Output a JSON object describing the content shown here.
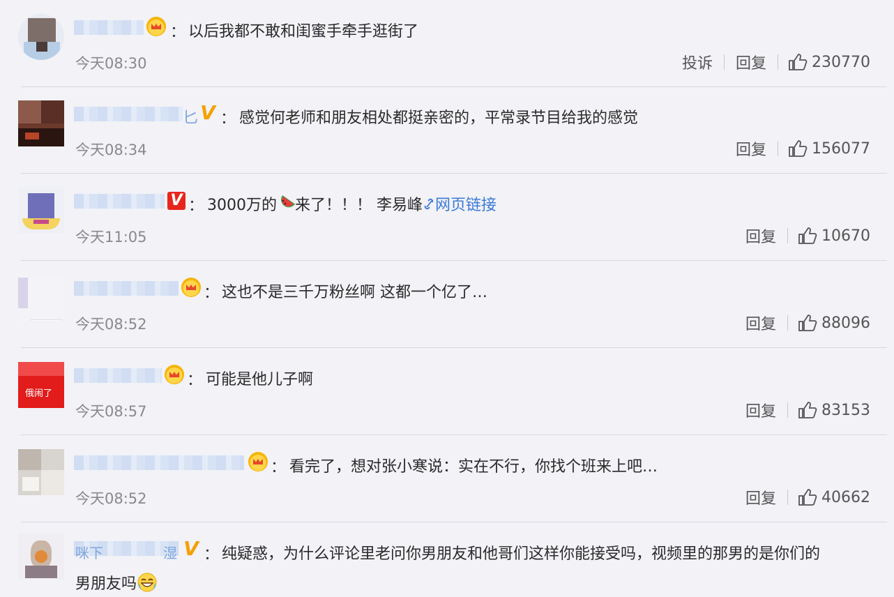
{
  "comments": [
    {
      "text": "以后我都不敢和闺蜜手牵手逛街了",
      "time": "今天08:30",
      "actions": [
        "投诉",
        "回复"
      ],
      "likes": "230770"
    },
    {
      "text": "感觉何老师和朋友相处都挺亲密的，平常录节目给我的感觉",
      "time": "今天08:34",
      "actions": [
        "回复"
      ],
      "likes": "156077"
    },
    {
      "text_before": "3000万的",
      "text_after": "来了！！！ 李易峰",
      "link": "网页链接",
      "time": "今天11:05",
      "actions": [
        "回复"
      ],
      "likes": "10670"
    },
    {
      "text": "这也不是三千万粉丝啊 这都一个亿了…",
      "time": "今天08:52",
      "actions": [
        "回复"
      ],
      "likes": "88096"
    },
    {
      "text": "可能是他儿子啊",
      "time": "今天08:57",
      "actions": [
        "回复"
      ],
      "likes": "83153"
    },
    {
      "text": "看完了，想对张小寒说：实在不行，你找个班来上吧…",
      "time": "今天08:52",
      "actions": [
        "回复"
      ],
      "likes": "40662"
    },
    {
      "text": "纯疑惑，为什么评论里老问你男朋友和他哥们这样你能接受吗，视频里的那男的是你们的",
      "text_line2": "男朋友吗"
    }
  ],
  "colon": "：",
  "name_fragments": {
    "c2": "匕",
    "c7a": "咪下",
    "c7b": "湿"
  },
  "avatar_text": {
    "c5": "俄闹了"
  },
  "colors": {
    "link": "#3a7ad6",
    "vip_v": "#f5a000",
    "crown": "#ffd54a",
    "timestamp": "#8a8a8a"
  },
  "icons": {
    "like": "thumbs-up-icon",
    "crown": "crown-badge-icon",
    "v": "v-badge-icon",
    "link": "link-icon",
    "watermelon": "watermelon-emoji-icon",
    "laugh": "laughing-emoji-icon"
  }
}
